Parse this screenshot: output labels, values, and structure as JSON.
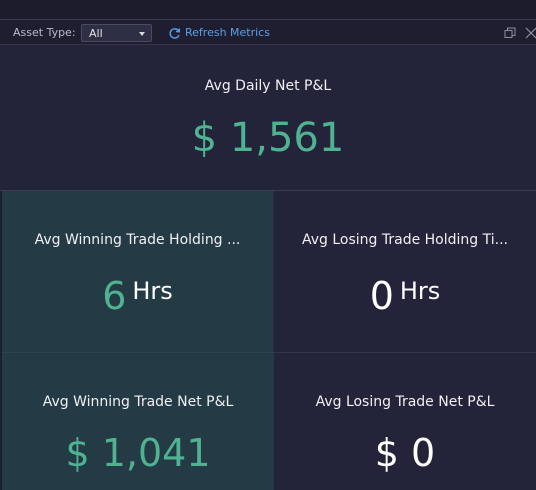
{
  "toolbar": {
    "asset_type_label": "Asset Type:",
    "asset_type_value": "All",
    "refresh_label": "Refresh Metrics",
    "restore_icon": "restore-window-icon",
    "close_icon": "close-icon",
    "refresh_icon": "refresh-icon",
    "link_color": "#5aa0e6"
  },
  "metrics": {
    "avg_daily_net_pl": {
      "title": "Avg Daily Net P&L",
      "value": "$ 1,561",
      "color": "#4fb391"
    },
    "avg_winning_holding": {
      "title": "Avg Winning Trade Holding ...",
      "value": "6",
      "unit": "Hrs",
      "color": "#4fb391"
    },
    "avg_losing_holding": {
      "title": "Avg Losing Trade Holding Ti...",
      "value": "0",
      "unit": "Hrs",
      "color": "#ffffff"
    },
    "avg_winning_net_pl": {
      "title": "Avg Winning Trade Net P&L",
      "value": "$ 1,041",
      "color": "#4fb391"
    },
    "avg_losing_net_pl": {
      "title": "Avg Losing Trade Net P&L",
      "value": "$ 0",
      "color": "#ffffff"
    }
  },
  "colors": {
    "background": "#23233a",
    "positive_tile": "#243b45",
    "positive_value": "#4fb391"
  }
}
